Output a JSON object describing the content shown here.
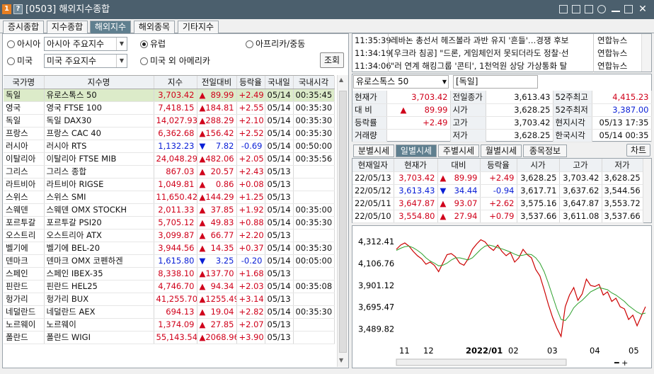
{
  "window": {
    "title": "[0503] 해외지수종합",
    "badge1": "1",
    "badge2": "?"
  },
  "tabs": [
    "증시종합",
    "지수종합",
    "해외지수",
    "해외종목",
    "기타지수"
  ],
  "filters": {
    "asia_label": "아시아",
    "asia_select": "아시아 주요지수",
    "europe_label": "유럽",
    "africa_label": "아프리카/중동",
    "us_label": "미국",
    "us_select": "미국 주요지수",
    "other_am_label": "미국 외 아메리카",
    "search_button": "조회",
    "selected": "유럽"
  },
  "table": {
    "headers": [
      "국가명",
      "지수명",
      "지수",
      "전일대비",
      "등락율",
      "국내일",
      "국내시각"
    ],
    "rows": [
      {
        "country": "독일",
        "name": "유로스톡스 50",
        "index": "3,703.42",
        "dir": "▲",
        "change": "89.99",
        "rate": "+2.49",
        "date": "05/14",
        "time": "00:35:45",
        "hl": true
      },
      {
        "country": "영국",
        "name": "영국 FTSE 100",
        "index": "7,418.15",
        "dir": "▲",
        "change": "184.81",
        "rate": "+2.55",
        "date": "05/14",
        "time": "00:35:30"
      },
      {
        "country": "독일",
        "name": "독일 DAX30",
        "index": "14,027.93",
        "dir": "▲",
        "change": "288.29",
        "rate": "+2.10",
        "date": "05/14",
        "time": "00:35:30"
      },
      {
        "country": "프랑스",
        "name": "프랑스 CAC 40",
        "index": "6,362.68",
        "dir": "▲",
        "change": "156.42",
        "rate": "+2.52",
        "date": "05/14",
        "time": "00:35:30"
      },
      {
        "country": "러시아",
        "name": "러시아 RTS",
        "index": "1,132.23",
        "dir": "▼",
        "change": "7.82",
        "rate": "-0.69",
        "date": "05/14",
        "time": "00:50:00"
      },
      {
        "country": "이탈리아",
        "name": "이탈리아 FTSE MIB",
        "index": "24,048.29",
        "dir": "▲",
        "change": "482.06",
        "rate": "+2.05",
        "date": "05/14",
        "time": "00:35:56"
      },
      {
        "country": "그리스",
        "name": "그리스 종합",
        "index": "867.03",
        "dir": "▲",
        "change": "20.57",
        "rate": "+2.43",
        "date": "05/13",
        "time": ""
      },
      {
        "country": "라트비아",
        "name": "라트비아 RIGSE",
        "index": "1,049.81",
        "dir": "▲",
        "change": "0.86",
        "rate": "+0.08",
        "date": "05/13",
        "time": ""
      },
      {
        "country": "스위스",
        "name": "스위스 SMI",
        "index": "11,650.42",
        "dir": "▲",
        "change": "144.29",
        "rate": "+1.25",
        "date": "05/13",
        "time": ""
      },
      {
        "country": "스웨덴",
        "name": "스웨덴 OMX STOCKH",
        "index": "2,011.33",
        "dir": "▲",
        "change": "37.85",
        "rate": "+1.92",
        "date": "05/14",
        "time": "00:35:00"
      },
      {
        "country": "포르투갈",
        "name": "포르투갈 PSI20",
        "index": "5,705.12",
        "dir": "▲",
        "change": "49.83",
        "rate": "+0.88",
        "date": "05/14",
        "time": "00:35:30"
      },
      {
        "country": "오스트리",
        "name": "오스트리아 ATX",
        "index": "3,099.87",
        "dir": "▲",
        "change": "66.77",
        "rate": "+2.20",
        "date": "05/13",
        "time": ""
      },
      {
        "country": "벨기에",
        "name": "벨기에 BEL-20",
        "index": "3,944.56",
        "dir": "▲",
        "change": "14.35",
        "rate": "+0.37",
        "date": "05/14",
        "time": "00:35:30"
      },
      {
        "country": "덴마크",
        "name": "덴마크 OMX 코펜하겐",
        "index": "1,615.80",
        "dir": "▼",
        "change": "3.25",
        "rate": "-0.20",
        "date": "05/14",
        "time": "00:05:00"
      },
      {
        "country": "스페인",
        "name": "스페인 IBEX-35",
        "index": "8,338.10",
        "dir": "▲",
        "change": "137.70",
        "rate": "+1.68",
        "date": "05/13",
        "time": ""
      },
      {
        "country": "핀란드",
        "name": "핀란드 HEL25",
        "index": "4,746.70",
        "dir": "▲",
        "change": "94.34",
        "rate": "+2.03",
        "date": "05/14",
        "time": "00:35:08"
      },
      {
        "country": "헝가리",
        "name": "헝가리 BUX",
        "index": "41,255.70",
        "dir": "▲",
        "change": "1255.49",
        "rate": "+3.14",
        "date": "05/13",
        "time": ""
      },
      {
        "country": "네덜란드",
        "name": "네덜란드 AEX",
        "index": "694.13",
        "dir": "▲",
        "change": "19.04",
        "rate": "+2.82",
        "date": "05/14",
        "time": "00:35:30"
      },
      {
        "country": "노르웨이",
        "name": "노르웨이",
        "index": "1,374.09",
        "dir": "▲",
        "change": "27.85",
        "rate": "+2.07",
        "date": "05/13",
        "time": ""
      },
      {
        "country": "폴란드",
        "name": "폴란드 WIGI",
        "index": "55,143.54",
        "dir": "▲",
        "change": "2068.96",
        "rate": "+3.90",
        "date": "05/13",
        "time": ""
      }
    ]
  },
  "news": [
    {
      "time": "11:35:39",
      "headline": "레바논 총선서 헤즈볼라 과반 유지 '흔들'…경쟁 후보",
      "src": "연합뉴스"
    },
    {
      "time": "11:34:19",
      "headline": "[우크라 침공] \"드론, 게임체인저 못되더라도 정찰·선",
      "src": "연합뉴스"
    },
    {
      "time": "11:34:06",
      "headline": "\"러 연계 해킹그룹 '콘티', 1천억원 상당 가상통화 탈",
      "src": "연합뉴스"
    }
  ],
  "detail": {
    "name": "유로스톡스 50",
    "country": "[독일]",
    "labels": {
      "cur": "현재가",
      "prev": "전일종가",
      "hi52": "52주최고",
      "chg": "대  비",
      "open": "시가",
      "lo52": "52주최저",
      "rate": "등락률",
      "high": "고가",
      "local": "현지시각",
      "vol": "거래량",
      "low": "저가",
      "korea": "한국시각"
    },
    "cur": "3,703.42",
    "prev": "3,613.43",
    "hi52": "4,415.23",
    "chg": "89.99",
    "chg_dir": "▲",
    "open": "3,628.25",
    "lo52": "3,387.00",
    "rate": "+2.49",
    "high": "3,703.42",
    "local": "05/13 17:35",
    "vol": "",
    "low": "3,628.25",
    "korea": "05/14 00:35"
  },
  "subtabs": [
    "분별시세",
    "일별시세",
    "주별시세",
    "월별시세",
    "종목정보"
  ],
  "chart_button": "차트",
  "daily": {
    "headers": [
      "현재일자",
      "현재가",
      "대비",
      "등락율",
      "시가",
      "고가",
      "저가"
    ],
    "rows": [
      {
        "date": "22/05/13",
        "price": "3,703.42",
        "dir": "▲",
        "chg": "89.99",
        "rate": "+2.49",
        "open": "3,628.25",
        "high": "3,703.42",
        "low": "3,628.25"
      },
      {
        "date": "22/05/12",
        "price": "3,613.43",
        "dir": "▼",
        "chg": "34.44",
        "rate": "-0.94",
        "open": "3,617.71",
        "high": "3,637.62",
        "low": "3,544.56"
      },
      {
        "date": "22/05/11",
        "price": "3,647.87",
        "dir": "▲",
        "chg": "93.07",
        "rate": "+2.62",
        "open": "3,575.16",
        "high": "3,647.87",
        "low": "3,553.72"
      },
      {
        "date": "22/05/10",
        "price": "3,554.80",
        "dir": "▲",
        "chg": "27.94",
        "rate": "+0.79",
        "open": "3,537.66",
        "high": "3,611.08",
        "low": "3,537.66"
      }
    ]
  },
  "chart_data": {
    "type": "line",
    "title": "",
    "y_ticks": [
      "4,312.41",
      "4,106.76",
      "3,901.12",
      "3,695.47",
      "3,489.82"
    ],
    "x_ticks": [
      "11",
      "12",
      "2022/01",
      "02",
      "03",
      "04",
      "05"
    ],
    "ylim": [
      3380,
      4420
    ],
    "series": [
      {
        "values": [
          4240,
          4280,
          4300,
          4270,
          4220,
          4180,
          4150,
          4100,
          4120,
          4090,
          4030,
          4110,
          4190,
          4200,
          4170,
          4110,
          4090,
          4150,
          4240,
          4290,
          4330,
          4310,
          4260,
          4230,
          4280,
          4220,
          4180,
          4210,
          4120,
          4160,
          4240,
          4190,
          4160,
          4050,
          3990,
          3860,
          3720,
          3600,
          3500,
          3420,
          3700,
          3810,
          3880,
          3760,
          3820,
          3960,
          3900,
          3890,
          3910,
          3810,
          3840,
          3750,
          3780,
          3700,
          3680,
          3580,
          3620,
          3520,
          3610,
          3700
        ],
        "color": "#cc0000"
      },
      {
        "values": [
          4230,
          4250,
          4265,
          4270,
          4255,
          4230,
          4200,
          4160,
          4130,
          4110,
          4085,
          4090,
          4110,
          4140,
          4160,
          4160,
          4150,
          4140,
          4160,
          4200,
          4240,
          4270,
          4280,
          4270,
          4255,
          4245,
          4230,
          4215,
          4195,
          4180,
          4185,
          4195,
          4190,
          4160,
          4110,
          4030,
          3920,
          3800,
          3680,
          3580,
          3570,
          3620,
          3690,
          3730,
          3760,
          3800,
          3840,
          3860,
          3880,
          3870,
          3860,
          3830,
          3810,
          3780,
          3750,
          3710,
          3680,
          3650,
          3630,
          3640
        ],
        "color": "#2ca02c"
      }
    ]
  }
}
